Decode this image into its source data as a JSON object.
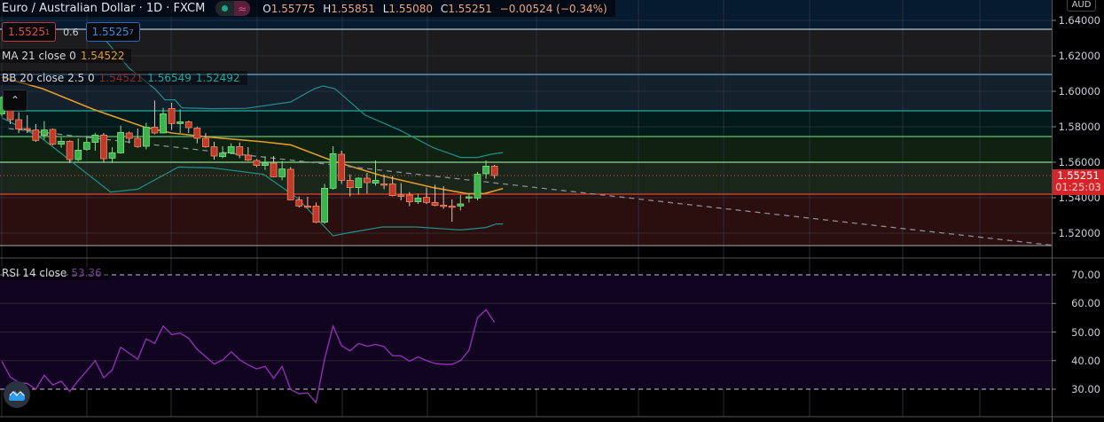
{
  "header": {
    "title": "Euro / Australian Dollar · 1D · FXCM",
    "ohlc": [
      {
        "label": "O",
        "value": "1.55775"
      },
      {
        "label": "H",
        "value": "1.55851"
      },
      {
        "label": "L",
        "value": "1.55080"
      },
      {
        "label": "C",
        "value": "1.55251"
      }
    ],
    "change": "−0.00524 (−0.34%)"
  },
  "trade": {
    "sell_main": "1.5525",
    "sell_pip": "1",
    "spread": "0.6",
    "buy_main": "1.5525",
    "buy_pip": "7"
  },
  "indicators": {
    "ma": {
      "label": "MA 21 close 0",
      "value": "1.54522"
    },
    "bb": {
      "label": "BB 20 close 2.5 0",
      "basis": "1.54521",
      "upper": "1.56549",
      "lower": "1.52492"
    },
    "rsi": {
      "label": "RSI 14 close",
      "value": "53.36"
    }
  },
  "price_axis": {
    "currency": "AUD",
    "ticks": [
      "1.64000",
      "1.62000",
      "1.60000",
      "1.58000",
      "1.56000",
      "1.54000",
      "1.52000"
    ],
    "last_price": "1.55251",
    "countdown": "01:25:03"
  },
  "rsi_axis": {
    "ticks": [
      "70.00",
      "60.00",
      "50.00",
      "40.00",
      "30.00"
    ]
  },
  "colors": {
    "up": "#3cb44b",
    "up_border": "#7ee08a",
    "down": "#c0392b",
    "down_border": "#f08a5d",
    "ma": "#e69a28",
    "bb": "#1f8f8a",
    "rsi": "#9b30c0",
    "last_price_bg": "#d4262a"
  },
  "chart_data": {
    "type": "candlestick",
    "title": "Euro / Australian Dollar · 1D · FXCM",
    "ylim": [
      1.5105,
      1.6455
    ],
    "yticks": [
      1.64,
      1.62,
      1.6,
      1.58,
      1.56,
      1.54,
      1.52
    ],
    "grid": true,
    "candles": [
      [
        1.5873,
        1.5973,
        1.5857,
        1.5965
      ],
      [
        1.5965,
        1.5973,
        1.5815,
        1.584
      ],
      [
        1.584,
        1.5882,
        1.5765,
        1.5787
      ],
      [
        1.579,
        1.5865,
        1.5765,
        1.5782
      ],
      [
        1.5782,
        1.5815,
        1.5715,
        1.5723
      ],
      [
        1.5752,
        1.5832,
        1.5728,
        1.5782
      ],
      [
        1.5785,
        1.579,
        1.5695,
        1.5702
      ],
      [
        1.5702,
        1.574,
        1.5682,
        1.5718
      ],
      [
        1.5718,
        1.5723,
        1.5595,
        1.5615
      ],
      [
        1.5615,
        1.5735,
        1.5607,
        1.5668
      ],
      [
        1.5673,
        1.5748,
        1.5665,
        1.5712
      ],
      [
        1.5712,
        1.5765,
        1.5665,
        1.5753
      ],
      [
        1.5753,
        1.5765,
        1.5598,
        1.562
      ],
      [
        1.5623,
        1.5685,
        1.5595,
        1.5653
      ],
      [
        1.5653,
        1.5807,
        1.5648,
        1.5768
      ],
      [
        1.5765,
        1.5773,
        1.5707,
        1.5735
      ],
      [
        1.5735,
        1.579,
        1.5682,
        1.5688
      ],
      [
        1.569,
        1.5823,
        1.5673,
        1.5798
      ],
      [
        1.5798,
        1.5948,
        1.5757,
        1.5765
      ],
      [
        1.5765,
        1.5907,
        1.5765,
        1.5873
      ],
      [
        1.5903,
        1.5935,
        1.5782,
        1.5818
      ],
      [
        1.5818,
        1.5898,
        1.5765,
        1.5828
      ],
      [
        1.5828,
        1.5835,
        1.5765,
        1.5795
      ],
      [
        1.5793,
        1.5802,
        1.5707,
        1.5735
      ],
      [
        1.5735,
        1.5765,
        1.5682,
        1.5687
      ],
      [
        1.5687,
        1.5715,
        1.5615,
        1.5635
      ],
      [
        1.5632,
        1.569,
        1.5623,
        1.5652
      ],
      [
        1.5652,
        1.5707,
        1.5645,
        1.5688
      ],
      [
        1.5688,
        1.5712,
        1.5623,
        1.564
      ],
      [
        1.564,
        1.5685,
        1.5607,
        1.5612
      ],
      [
        1.561,
        1.5618,
        1.5573,
        1.5582
      ],
      [
        1.5582,
        1.5632,
        1.5557,
        1.5595
      ],
      [
        1.5595,
        1.5635,
        1.5515,
        1.5518
      ],
      [
        1.5518,
        1.5607,
        1.5498,
        1.5562
      ],
      [
        1.556,
        1.5573,
        1.5385,
        1.5388
      ],
      [
        1.5388,
        1.5407,
        1.5345,
        1.5353
      ],
      [
        1.5353,
        1.5405,
        1.5343,
        1.535
      ],
      [
        1.5353,
        1.5373,
        1.5257,
        1.5262
      ],
      [
        1.5262,
        1.5478,
        1.5252,
        1.5453
      ],
      [
        1.5453,
        1.569,
        1.5445,
        1.5648
      ],
      [
        1.5645,
        1.5665,
        1.5478,
        1.5498
      ],
      [
        1.5498,
        1.5532,
        1.5407,
        1.5457
      ],
      [
        1.5457,
        1.5515,
        1.5418,
        1.551
      ],
      [
        1.551,
        1.554,
        1.5423,
        1.5485
      ],
      [
        1.5482,
        1.561,
        1.5468,
        1.5498
      ],
      [
        1.5478,
        1.5532,
        1.5448,
        1.5477
      ],
      [
        1.5478,
        1.5523,
        1.5407,
        1.5412
      ],
      [
        1.5415,
        1.5482,
        1.5385,
        1.5412
      ],
      [
        1.5415,
        1.5432,
        1.5352,
        1.5377
      ],
      [
        1.5377,
        1.5423,
        1.5365,
        1.5398
      ],
      [
        1.5402,
        1.5457,
        1.5365,
        1.5373
      ],
      [
        1.5373,
        1.5473,
        1.5352,
        1.5357
      ],
      [
        1.5358,
        1.5465,
        1.5337,
        1.5352
      ],
      [
        1.5353,
        1.539,
        1.5265,
        1.5352
      ],
      [
        1.5353,
        1.5415,
        1.5328,
        1.5365
      ],
      [
        1.5398,
        1.5423,
        1.5373,
        1.5405
      ],
      [
        1.5398,
        1.5545,
        1.5385,
        1.5532
      ],
      [
        1.5535,
        1.561,
        1.5507,
        1.5578
      ],
      [
        1.55775,
        1.55851,
        1.5508,
        1.55251
      ]
    ],
    "ma21": [
      [
        0,
        1.608
      ],
      [
        4.8,
        1.6015
      ],
      [
        10.8,
        1.5898
      ],
      [
        16.8,
        1.5798
      ],
      [
        20,
        1.5765
      ],
      [
        24.8,
        1.574
      ],
      [
        30.8,
        1.5715
      ],
      [
        34,
        1.5698
      ],
      [
        39,
        1.5607
      ],
      [
        44.8,
        1.5523
      ],
      [
        50.8,
        1.5457
      ],
      [
        54.8,
        1.5423
      ],
      [
        56.8,
        1.5423
      ],
      [
        59,
        1.5452
      ]
    ],
    "bb_upper": [
      [
        12,
        1.63
      ],
      [
        15,
        1.613
      ],
      [
        18,
        1.6015
      ],
      [
        19.2,
        1.5952
      ],
      [
        20.4,
        1.5952
      ],
      [
        21.2,
        1.5907
      ],
      [
        24.8,
        1.5902
      ],
      [
        28.8,
        1.5904
      ],
      [
        34,
        1.594
      ],
      [
        36.8,
        1.6015
      ],
      [
        37.8,
        1.603
      ],
      [
        39.2,
        1.6015
      ],
      [
        42.8,
        1.5865
      ],
      [
        46.8,
        1.5782
      ],
      [
        50.8,
        1.5682
      ],
      [
        54,
        1.5627
      ],
      [
        56,
        1.5627
      ],
      [
        57.6,
        1.5645
      ],
      [
        59,
        1.5655
      ]
    ],
    "bb_lower": [
      [
        0,
        1.585
      ],
      [
        0.8,
        1.5832
      ],
      [
        4.8,
        1.5732
      ],
      [
        8.8,
        1.5582
      ],
      [
        12.8,
        1.5432
      ],
      [
        16,
        1.5448
      ],
      [
        20.8,
        1.5573
      ],
      [
        24.8,
        1.5568
      ],
      [
        30.8,
        1.5532
      ],
      [
        34.8,
        1.5398
      ],
      [
        39,
        1.5185
      ],
      [
        40.8,
        1.5202
      ],
      [
        44.8,
        1.5235
      ],
      [
        48.8,
        1.5235
      ],
      [
        54,
        1.5218
      ],
      [
        57,
        1.5232
      ],
      [
        58.2,
        1.5252
      ],
      [
        59,
        1.5252
      ]
    ],
    "trend_line": [
      [
        0.8,
        1.579
      ],
      [
        124,
        1.513
      ]
    ],
    "fib_levels": [
      {
        "price": 1.635,
        "line": "#b8c4d0",
        "fill_below": "#1c1c1e"
      },
      {
        "price": 1.6095,
        "line": "#5fa8e8",
        "fill_below": "#15202d"
      },
      {
        "price": 1.589,
        "line": "#26a6a0",
        "fill_below": "#031a1b"
      },
      {
        "price": 1.5745,
        "line": "#5ec46a",
        "fill_below": "#0f2212"
      },
      {
        "price": 1.56,
        "line": "#8fd88f",
        "fill_below": "#1a2619"
      },
      {
        "price": 1.542,
        "line": "#e0453a",
        "fill_below": "#2b0f0f"
      },
      {
        "price": 1.513,
        "line": "#8a8a8a",
        "fill_below": null
      }
    ],
    "fib_top_fill": "#061a30",
    "rsi": {
      "ylim": [
        30,
        70
      ],
      "levels": [
        70,
        30
      ],
      "values": [
        39.8,
        34.3,
        32.3,
        32.0,
        30.0,
        34.9,
        31.5,
        32.8,
        29.2,
        33.0,
        36.4,
        40.0,
        34.0,
        36.7,
        44.7,
        42.6,
        40.5,
        47.6,
        46.0,
        52.1,
        49.1,
        49.6,
        47.8,
        43.9,
        41.4,
        38.8,
        40.2,
        43.1,
        40.3,
        38.5,
        37.1,
        38.0,
        33.8,
        38.0,
        29.9,
        28.4,
        28.7,
        25.3,
        40.5,
        52.1,
        45.2,
        43.4,
        46.0,
        45.0,
        45.7,
        44.9,
        41.7,
        41.7,
        39.8,
        41.3,
        40.0,
        39.0,
        38.7,
        38.7,
        40.0,
        43.6,
        55.0,
        57.8,
        53.36
      ]
    }
  }
}
